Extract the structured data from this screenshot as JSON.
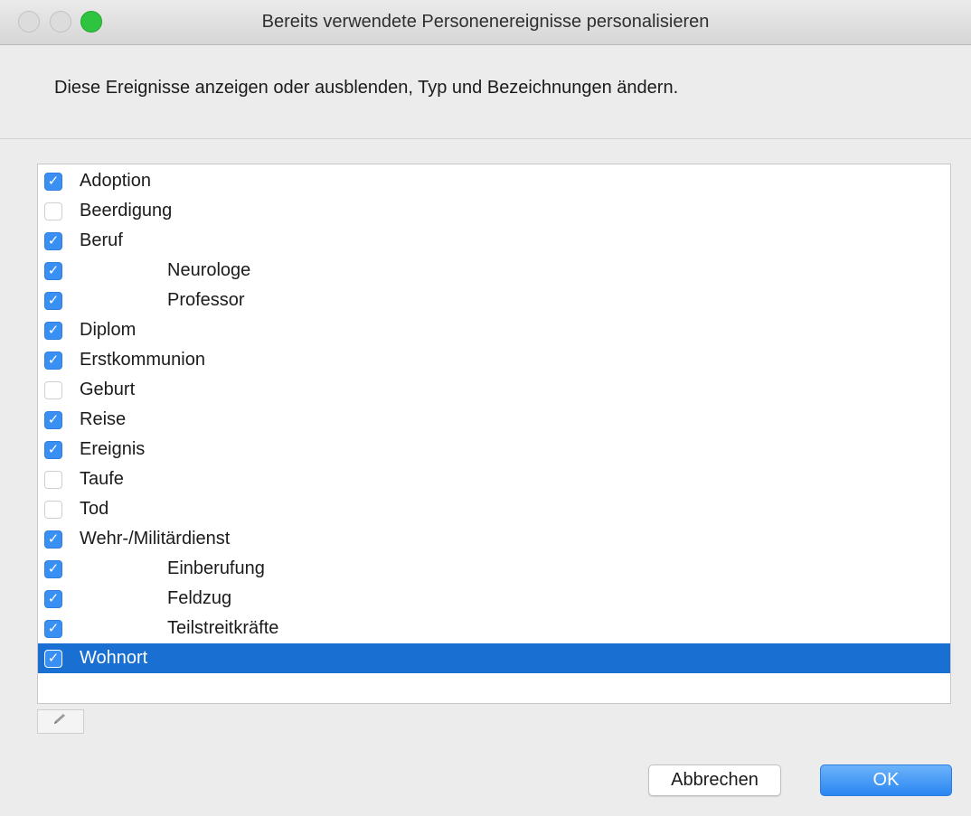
{
  "window": {
    "title": "Bereits verwendete Personenereignisse personalisieren",
    "accent_color": "#1a6fd3"
  },
  "description": "Diese Ereignisse anzeigen oder ausblenden, Typ und Bezeichnungen ändern.",
  "events": [
    {
      "label": "Adoption",
      "checked": true,
      "indent": 0,
      "selected": false
    },
    {
      "label": "Beerdigung",
      "checked": false,
      "indent": 0,
      "selected": false
    },
    {
      "label": "Beruf",
      "checked": true,
      "indent": 0,
      "selected": false
    },
    {
      "label": "Neurologe",
      "checked": true,
      "indent": 1,
      "selected": false
    },
    {
      "label": "Professor",
      "checked": true,
      "indent": 1,
      "selected": false
    },
    {
      "label": "Diplom",
      "checked": true,
      "indent": 0,
      "selected": false
    },
    {
      "label": "Erstkommunion",
      "checked": true,
      "indent": 0,
      "selected": false
    },
    {
      "label": "Geburt",
      "checked": false,
      "indent": 0,
      "selected": false
    },
    {
      "label": "Reise",
      "checked": true,
      "indent": 0,
      "selected": false
    },
    {
      "label": "Ereignis",
      "checked": true,
      "indent": 0,
      "selected": false
    },
    {
      "label": "Taufe",
      "checked": false,
      "indent": 0,
      "selected": false
    },
    {
      "label": "Tod",
      "checked": false,
      "indent": 0,
      "selected": false
    },
    {
      "label": "Wehr-/Militärdienst",
      "checked": true,
      "indent": 0,
      "selected": false
    },
    {
      "label": "Einberufung",
      "checked": true,
      "indent": 1,
      "selected": false
    },
    {
      "label": "Feldzug",
      "checked": true,
      "indent": 1,
      "selected": false
    },
    {
      "label": "Teilstreitkräfte",
      "checked": true,
      "indent": 1,
      "selected": false
    },
    {
      "label": "Wohnort",
      "checked": true,
      "indent": 0,
      "selected": true
    }
  ],
  "toolbar": {
    "edit_icon": "pencil-icon"
  },
  "buttons": {
    "cancel_label": "Abbrechen",
    "ok_label": "OK"
  }
}
